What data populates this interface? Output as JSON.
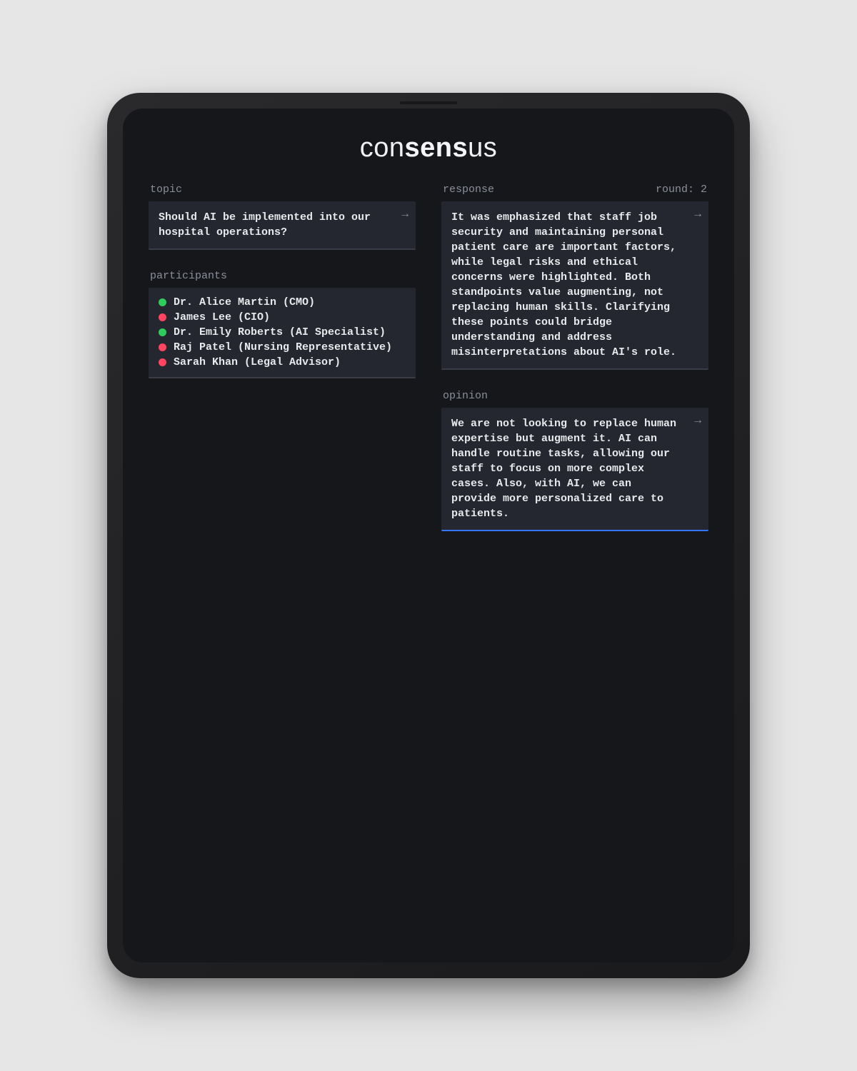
{
  "app": {
    "logo_pre": "con",
    "logo_mid": "sens",
    "logo_post": "us"
  },
  "left": {
    "topic_label": "topic",
    "topic_text": "Should AI be implemented into our hospital operations?",
    "participants_label": "participants",
    "participants": [
      {
        "name": "Dr. Alice Martin (CMO)",
        "status": "green"
      },
      {
        "name": "James Lee (CIO)",
        "status": "red"
      },
      {
        "name": "Dr. Emily Roberts (AI Specialist)",
        "status": "green"
      },
      {
        "name": "Raj Patel (Nursing Representative)",
        "status": "red"
      },
      {
        "name": "Sarah Khan (Legal Advisor)",
        "status": "red"
      }
    ]
  },
  "right": {
    "response_label": "response",
    "round_label": "round: 2",
    "response_text": "It was emphasized that staff job security and maintaining personal patient care are important factors, while legal risks and ethical concerns were highlighted. Both standpoints value augmenting, not replacing human skills. Clarifying these points could bridge understanding and address misinterpretations about AI's role.",
    "opinion_label": "opinion",
    "opinion_text": "We are not looking to replace human expertise but augment it. AI can handle routine tasks, allowing our staff to focus on more complex cases. Also, with AI, we can provide more personalized care to patients."
  },
  "colors": {
    "accent": "#3476ff",
    "green": "#2ecc5a",
    "red": "#ff455f"
  }
}
